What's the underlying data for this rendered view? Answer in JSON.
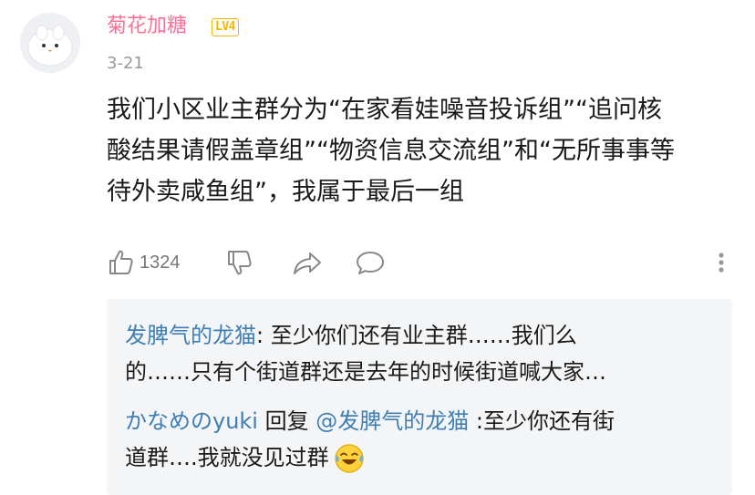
{
  "comment": {
    "username": "菊花加糖",
    "level": "LV4",
    "date": "3-21",
    "text_lines": [
      "我们小区业主群分为“在家看娃噪音投诉组”“追问核",
      "酸结果请假盖章组”“物资信息交流组”和“无所事事等",
      "待外卖咸鱼组”，我属于最后一组"
    ],
    "likes": "1324",
    "icons": {
      "like": "thumbs-up-icon",
      "dislike": "thumbs-down-icon",
      "share": "share-icon",
      "reply": "comment-icon",
      "more": "more-vertical-icon"
    }
  },
  "replies": [
    {
      "name": "发脾气的龙猫",
      "separator": ":",
      "line1_text": " 至少你们还有业主群……我们么",
      "line2_text": "的……只有个街道群还是去年的时候街道喊大家…"
    },
    {
      "name": "かなめのyuki",
      "reply_word": " 回复 ",
      "mention": "@发脾气的龙猫",
      "line1_text": " :至少你还有街",
      "line2_text": "道群….我就没见过群",
      "emoji": "laughing-tears-emoji"
    }
  ],
  "colors": {
    "username": "#fb7299",
    "level_badge": "#f7b500",
    "reply_name": "#3f7fb3",
    "reply_bg": "#f4f5f7",
    "meta_gray": "#999999"
  }
}
